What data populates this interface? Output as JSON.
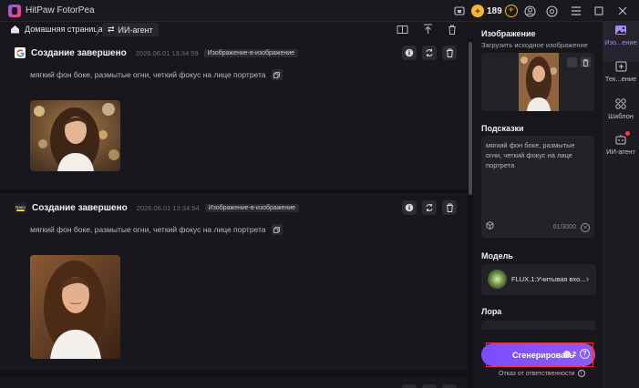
{
  "app": {
    "title": "HitPaw FotorPea",
    "credits": "189"
  },
  "nav": {
    "home": "Домашняя страница",
    "agent": "ИИ-агент"
  },
  "feed": {
    "cards": [
      {
        "title": "Создание завершено",
        "time": "2026.06.01  13:34:59",
        "tag": "Изображение-в-изображение",
        "prompt": "мягкий фон боке, размытые огни, четкий фокус на лице портрета",
        "source_icon": "google-icon"
      },
      {
        "title": "Создание завершено",
        "time": "2026.06.01  13:34:54",
        "tag": "Изображение-в-изображение",
        "prompt": "мягкий фон боке, размытые огни, четкий фокус на лице портрета",
        "source_icon": "nano-banana-icon",
        "source_label": "Nano"
      }
    ]
  },
  "panel": {
    "image_title": "Изображение",
    "upload_label": "Загрузить исходное изображение",
    "prompts_title": "Подсказки",
    "prompt_text": "мягкий фон боке, размытые огни, четкий фокус на лице портрета",
    "counter": "61/3000",
    "model_title": "Модель",
    "model_name": "FLUX.1:Учитывая вхо...",
    "lora_title": "Лора",
    "generate_label": "Сгенерировать",
    "generate_cost": "2",
    "disclaimer": "Отказ от ответственности"
  },
  "rail": {
    "items": [
      {
        "label": "Изо...ение",
        "icon": "image-icon"
      },
      {
        "label": "Тек...ение",
        "icon": "text-image-icon"
      },
      {
        "label": "Шаблон",
        "icon": "template-icon"
      },
      {
        "label": "ИИ-агент",
        "icon": "ai-agent-icon"
      }
    ]
  },
  "colors": {
    "accent": "#8b5cf6",
    "credit": "#f5b82e",
    "highlight": "#ff2a2a"
  }
}
